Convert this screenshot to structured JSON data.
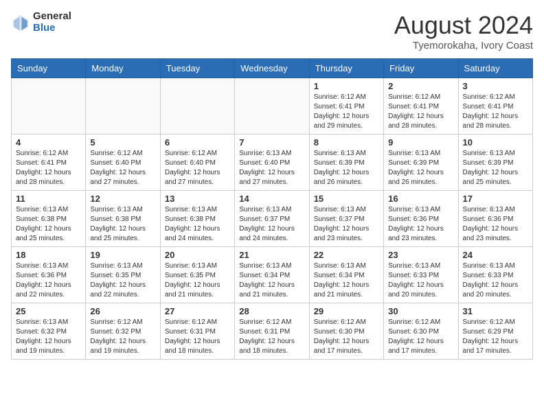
{
  "header": {
    "logo_general": "General",
    "logo_blue": "Blue",
    "month_year": "August 2024",
    "location": "Tyemorokaha, Ivory Coast"
  },
  "weekdays": [
    "Sunday",
    "Monday",
    "Tuesday",
    "Wednesday",
    "Thursday",
    "Friday",
    "Saturday"
  ],
  "weeks": [
    [
      {
        "day": "",
        "info": ""
      },
      {
        "day": "",
        "info": ""
      },
      {
        "day": "",
        "info": ""
      },
      {
        "day": "",
        "info": ""
      },
      {
        "day": "1",
        "info": "Sunrise: 6:12 AM\nSunset: 6:41 PM\nDaylight: 12 hours\nand 29 minutes."
      },
      {
        "day": "2",
        "info": "Sunrise: 6:12 AM\nSunset: 6:41 PM\nDaylight: 12 hours\nand 28 minutes."
      },
      {
        "day": "3",
        "info": "Sunrise: 6:12 AM\nSunset: 6:41 PM\nDaylight: 12 hours\nand 28 minutes."
      }
    ],
    [
      {
        "day": "4",
        "info": "Sunrise: 6:12 AM\nSunset: 6:41 PM\nDaylight: 12 hours\nand 28 minutes."
      },
      {
        "day": "5",
        "info": "Sunrise: 6:12 AM\nSunset: 6:40 PM\nDaylight: 12 hours\nand 27 minutes."
      },
      {
        "day": "6",
        "info": "Sunrise: 6:12 AM\nSunset: 6:40 PM\nDaylight: 12 hours\nand 27 minutes."
      },
      {
        "day": "7",
        "info": "Sunrise: 6:13 AM\nSunset: 6:40 PM\nDaylight: 12 hours\nand 27 minutes."
      },
      {
        "day": "8",
        "info": "Sunrise: 6:13 AM\nSunset: 6:39 PM\nDaylight: 12 hours\nand 26 minutes."
      },
      {
        "day": "9",
        "info": "Sunrise: 6:13 AM\nSunset: 6:39 PM\nDaylight: 12 hours\nand 26 minutes."
      },
      {
        "day": "10",
        "info": "Sunrise: 6:13 AM\nSunset: 6:39 PM\nDaylight: 12 hours\nand 25 minutes."
      }
    ],
    [
      {
        "day": "11",
        "info": "Sunrise: 6:13 AM\nSunset: 6:38 PM\nDaylight: 12 hours\nand 25 minutes."
      },
      {
        "day": "12",
        "info": "Sunrise: 6:13 AM\nSunset: 6:38 PM\nDaylight: 12 hours\nand 25 minutes."
      },
      {
        "day": "13",
        "info": "Sunrise: 6:13 AM\nSunset: 6:38 PM\nDaylight: 12 hours\nand 24 minutes."
      },
      {
        "day": "14",
        "info": "Sunrise: 6:13 AM\nSunset: 6:37 PM\nDaylight: 12 hours\nand 24 minutes."
      },
      {
        "day": "15",
        "info": "Sunrise: 6:13 AM\nSunset: 6:37 PM\nDaylight: 12 hours\nand 23 minutes."
      },
      {
        "day": "16",
        "info": "Sunrise: 6:13 AM\nSunset: 6:36 PM\nDaylight: 12 hours\nand 23 minutes."
      },
      {
        "day": "17",
        "info": "Sunrise: 6:13 AM\nSunset: 6:36 PM\nDaylight: 12 hours\nand 23 minutes."
      }
    ],
    [
      {
        "day": "18",
        "info": "Sunrise: 6:13 AM\nSunset: 6:36 PM\nDaylight: 12 hours\nand 22 minutes."
      },
      {
        "day": "19",
        "info": "Sunrise: 6:13 AM\nSunset: 6:35 PM\nDaylight: 12 hours\nand 22 minutes."
      },
      {
        "day": "20",
        "info": "Sunrise: 6:13 AM\nSunset: 6:35 PM\nDaylight: 12 hours\nand 21 minutes."
      },
      {
        "day": "21",
        "info": "Sunrise: 6:13 AM\nSunset: 6:34 PM\nDaylight: 12 hours\nand 21 minutes."
      },
      {
        "day": "22",
        "info": "Sunrise: 6:13 AM\nSunset: 6:34 PM\nDaylight: 12 hours\nand 21 minutes."
      },
      {
        "day": "23",
        "info": "Sunrise: 6:13 AM\nSunset: 6:33 PM\nDaylight: 12 hours\nand 20 minutes."
      },
      {
        "day": "24",
        "info": "Sunrise: 6:13 AM\nSunset: 6:33 PM\nDaylight: 12 hours\nand 20 minutes."
      }
    ],
    [
      {
        "day": "25",
        "info": "Sunrise: 6:13 AM\nSunset: 6:32 PM\nDaylight: 12 hours\nand 19 minutes."
      },
      {
        "day": "26",
        "info": "Sunrise: 6:12 AM\nSunset: 6:32 PM\nDaylight: 12 hours\nand 19 minutes."
      },
      {
        "day": "27",
        "info": "Sunrise: 6:12 AM\nSunset: 6:31 PM\nDaylight: 12 hours\nand 18 minutes."
      },
      {
        "day": "28",
        "info": "Sunrise: 6:12 AM\nSunset: 6:31 PM\nDaylight: 12 hours\nand 18 minutes."
      },
      {
        "day": "29",
        "info": "Sunrise: 6:12 AM\nSunset: 6:30 PM\nDaylight: 12 hours\nand 17 minutes."
      },
      {
        "day": "30",
        "info": "Sunrise: 6:12 AM\nSunset: 6:30 PM\nDaylight: 12 hours\nand 17 minutes."
      },
      {
        "day": "31",
        "info": "Sunrise: 6:12 AM\nSunset: 6:29 PM\nDaylight: 12 hours\nand 17 minutes."
      }
    ]
  ]
}
